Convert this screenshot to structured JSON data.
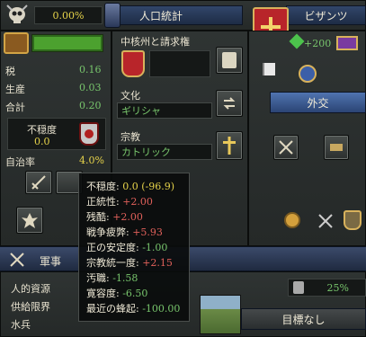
{
  "top": {
    "percent": "0.00%",
    "tab_title": "人口統計",
    "nation_name": "ビザンツ",
    "plus_value": "+200"
  },
  "stats": {
    "tax_label": "税",
    "tax_value": "0.16",
    "production_label": "生産",
    "production_value": "0.03",
    "total_label": "合計",
    "total_value": "0.20",
    "unrest_label": "不穏度",
    "unrest_value": "0.0",
    "autonomy_label": "自治率",
    "autonomy_value": "4.0%"
  },
  "center": {
    "core_label": "中核州と請求権",
    "culture_label": "文化",
    "culture_value": "ギリシャ",
    "religion_label": "宗教",
    "religion_value": "カトリック"
  },
  "diplomacy": {
    "label": "外交"
  },
  "military": {
    "title": "軍事",
    "manpower_label": "人的資源",
    "supply_label": "供給限界",
    "soldiers_label": "水兵",
    "progress_value": "25%",
    "goal_label": "目標なし"
  },
  "tooltip": {
    "lines": [
      {
        "label": "不穏度: ",
        "value": "0.0 (-96.9)",
        "color": "#e6d34a"
      },
      {
        "label": "正統性: ",
        "value": "+2.00",
        "color": "#e0605a"
      },
      {
        "label": "残酷: ",
        "value": "+2.00",
        "color": "#e0605a"
      },
      {
        "label": "戦争疲弊: ",
        "value": "+5.93",
        "color": "#e0605a"
      },
      {
        "label": "正の安定度: ",
        "value": "-1.00",
        "color": "#78c56c"
      },
      {
        "label": "宗教統一度: ",
        "value": "+2.15",
        "color": "#e0605a"
      },
      {
        "label": "汚職: ",
        "value": "-1.58",
        "color": "#78c56c"
      },
      {
        "label": "寛容度: ",
        "value": "-6.50",
        "color": "#78c56c"
      },
      {
        "label": "最近の蜂起: ",
        "value": "-100.00",
        "color": "#78c56c"
      }
    ]
  },
  "colors": {
    "accent_blue": "#32466a",
    "positive": "#78c56c",
    "negative": "#e0605a",
    "highlight": "#e6d34a"
  }
}
